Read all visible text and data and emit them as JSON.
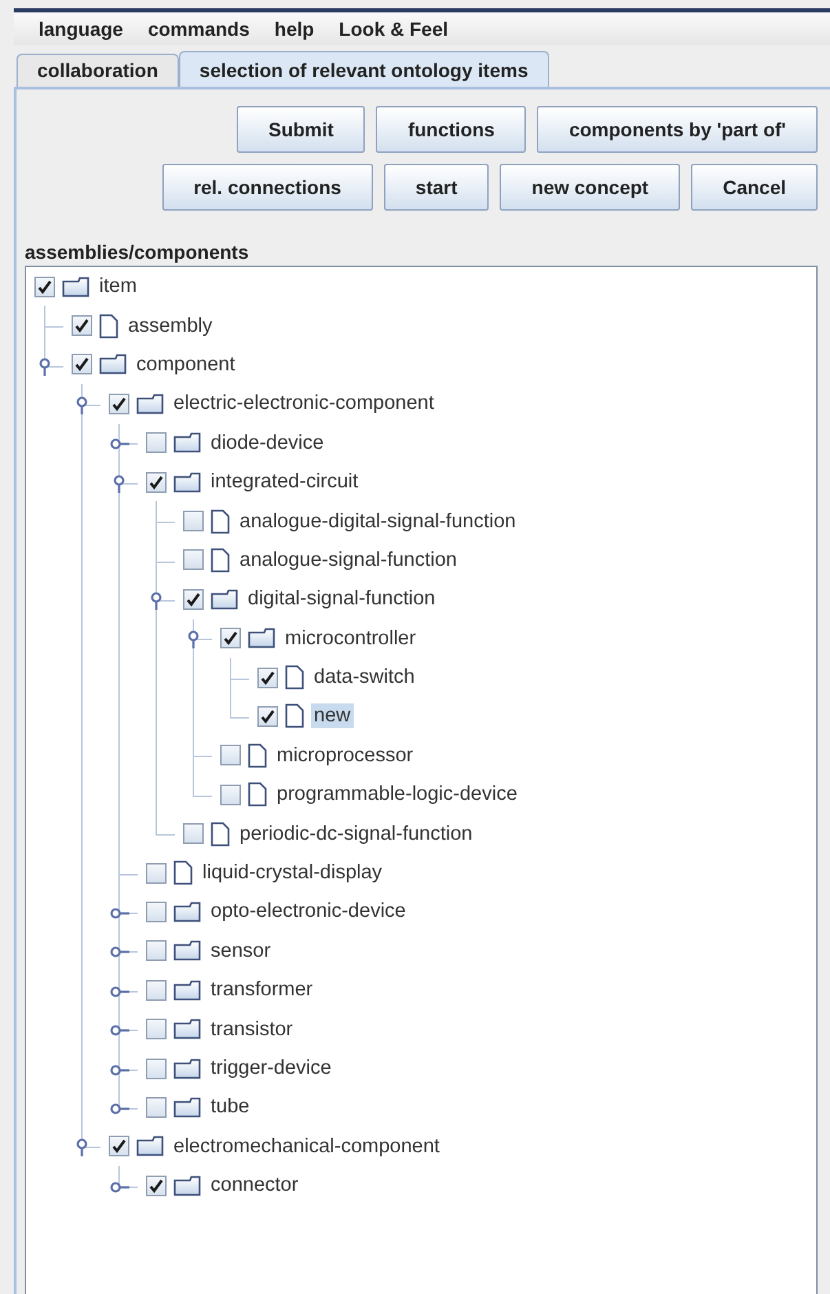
{
  "menu": [
    {
      "label": "language"
    },
    {
      "label": "commands"
    },
    {
      "label": "help"
    },
    {
      "label": "Look & Feel"
    }
  ],
  "tabs": [
    {
      "label": "collaboration",
      "selected": false
    },
    {
      "label": "selection of relevant ontology items",
      "selected": true
    }
  ],
  "button_rows": [
    [
      "Submit",
      "functions",
      "components by 'part of'"
    ],
    [
      "rel. connections",
      "start",
      "new concept",
      "Cancel"
    ]
  ],
  "tree_label": "assemblies/components",
  "tree": [
    {
      "label": "item",
      "kind": "folder",
      "checked": true,
      "selected": false,
      "children": [
        {
          "label": "assembly",
          "kind": "document",
          "checked": true,
          "selected": false
        },
        {
          "label": "component",
          "kind": "folder",
          "checked": true,
          "selected": false,
          "expanded": true,
          "children": [
            {
              "label": "electric-electronic-component",
              "kind": "folder",
              "checked": true,
              "selected": false,
              "expanded": true,
              "children": [
                {
                  "label": "diode-device",
                  "kind": "folder",
                  "checked": false,
                  "selected": false,
                  "expanded": false
                },
                {
                  "label": "integrated-circuit",
                  "kind": "folder",
                  "checked": true,
                  "selected": false,
                  "expanded": true,
                  "children": [
                    {
                      "label": "analogue-digital-signal-function",
                      "kind": "document",
                      "checked": false,
                      "selected": false
                    },
                    {
                      "label": "analogue-signal-function",
                      "kind": "document",
                      "checked": false,
                      "selected": false
                    },
                    {
                      "label": "digital-signal-function",
                      "kind": "folder",
                      "checked": true,
                      "selected": false,
                      "expanded": true,
                      "children": [
                        {
                          "label": "microcontroller",
                          "kind": "folder",
                          "checked": true,
                          "selected": false,
                          "expanded": true,
                          "children": [
                            {
                              "label": "data-switch",
                              "kind": "document",
                              "checked": true,
                              "selected": false
                            },
                            {
                              "label": "new",
                              "kind": "document",
                              "checked": true,
                              "selected": true
                            }
                          ]
                        },
                        {
                          "label": "microprocessor",
                          "kind": "document",
                          "checked": false,
                          "selected": false
                        },
                        {
                          "label": "programmable-logic-device",
                          "kind": "document",
                          "checked": false,
                          "selected": false
                        }
                      ]
                    },
                    {
                      "label": "periodic-dc-signal-function",
                      "kind": "document",
                      "checked": false,
                      "selected": false
                    }
                  ]
                },
                {
                  "label": "liquid-crystal-display",
                  "kind": "document",
                  "checked": false,
                  "selected": false
                },
                {
                  "label": "opto-electronic-device",
                  "kind": "folder",
                  "checked": false,
                  "selected": false,
                  "expanded": false
                },
                {
                  "label": "sensor",
                  "kind": "folder",
                  "checked": false,
                  "selected": false,
                  "expanded": false
                },
                {
                  "label": "transformer",
                  "kind": "folder",
                  "checked": false,
                  "selected": false,
                  "expanded": false
                },
                {
                  "label": "transistor",
                  "kind": "folder",
                  "checked": false,
                  "selected": false,
                  "expanded": false
                },
                {
                  "label": "trigger-device",
                  "kind": "folder",
                  "checked": false,
                  "selected": false,
                  "expanded": false
                },
                {
                  "label": "tube",
                  "kind": "folder",
                  "checked": false,
                  "selected": false,
                  "expanded": false
                }
              ]
            },
            {
              "label": "electromechanical-component",
              "kind": "folder",
              "checked": true,
              "selected": false,
              "expanded": true,
              "children": [
                {
                  "label": "connector",
                  "kind": "folder",
                  "checked": true,
                  "selected": false,
                  "expanded": false
                }
              ]
            }
          ]
        }
      ]
    }
  ]
}
